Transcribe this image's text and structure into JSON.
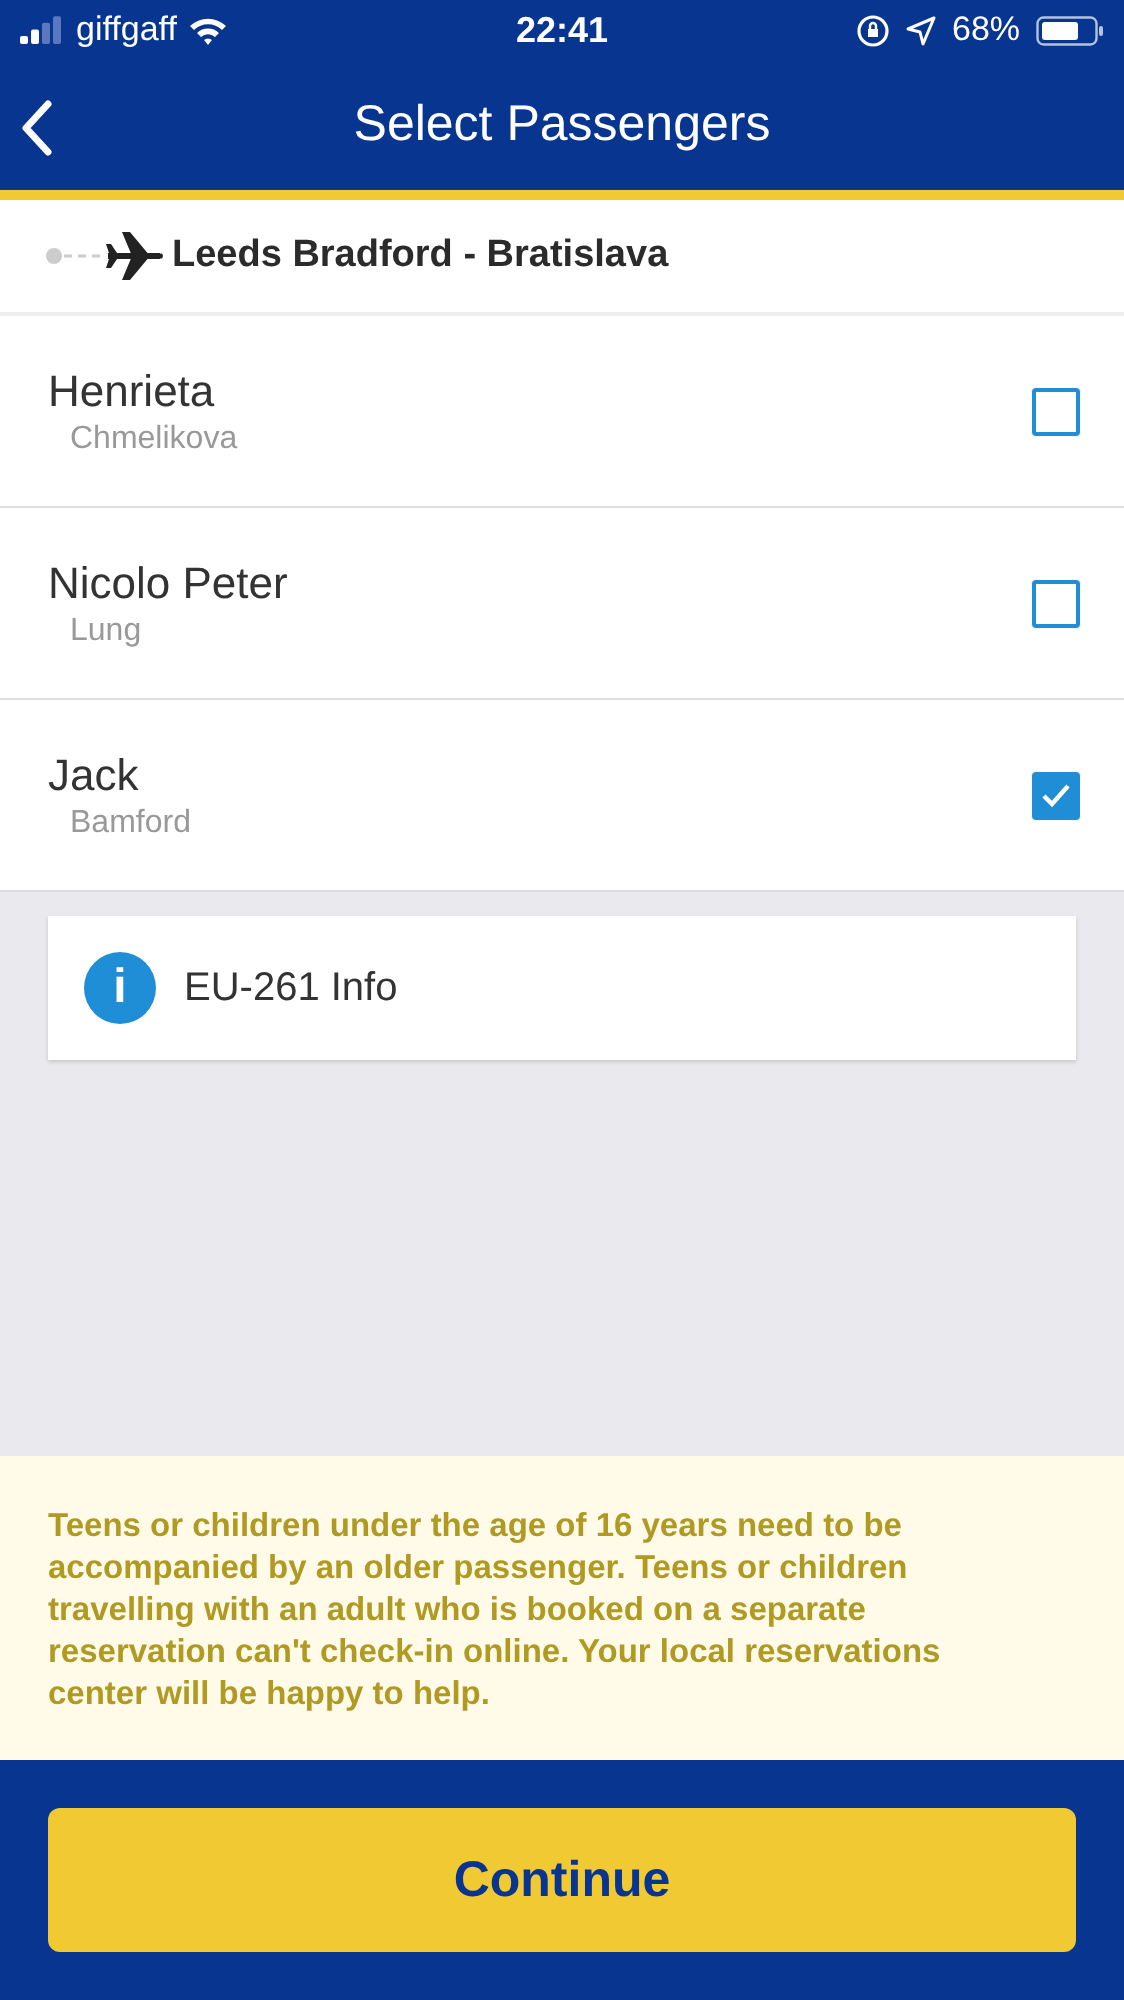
{
  "status_bar": {
    "carrier": "giffgaff",
    "time": "22:41",
    "battery": "68%"
  },
  "nav": {
    "title": "Select Passengers"
  },
  "route": {
    "title": "Leeds Bradford - Bratislava"
  },
  "passengers": [
    {
      "first_name": "Henrieta",
      "last_name": "Chmelikova",
      "checked": false
    },
    {
      "first_name": "Nicolo Peter",
      "last_name": "Lung",
      "checked": false
    },
    {
      "first_name": "Jack",
      "last_name": "Bamford",
      "checked": true
    }
  ],
  "info_card": {
    "label": "EU-261 Info",
    "icon": "i"
  },
  "notice": "Teens or children under the age of 16 years need to be accompanied by an older passenger. Teens or children travelling with an adult who is booked on a separate reservation can't check-in online. Your local reservations center will be happy to help.",
  "continue_button": "Continue"
}
